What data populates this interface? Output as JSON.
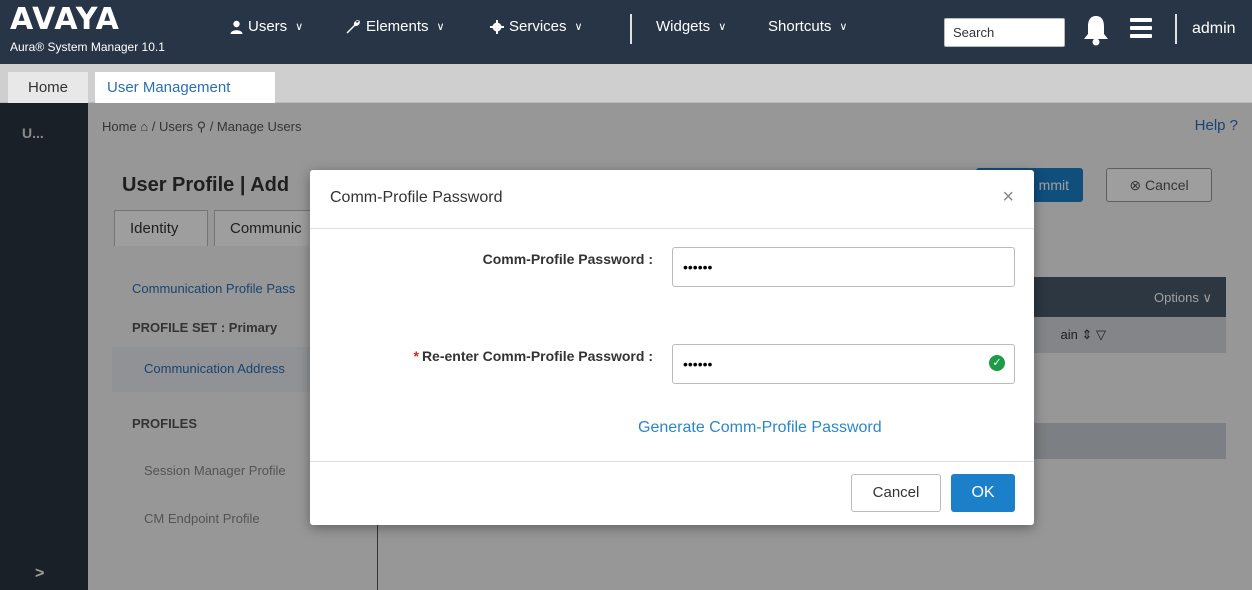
{
  "topbar": {
    "logo": "AVAYA",
    "product": "Aura® System Manager 10.1",
    "nav": [
      {
        "label": "Users",
        "icon": "user-icon"
      },
      {
        "label": "Elements",
        "icon": "wrench-icon"
      },
      {
        "label": "Services",
        "icon": "gear-icon"
      },
      {
        "label": "Widgets"
      },
      {
        "label": "Shortcuts"
      }
    ],
    "search_value": "Search",
    "user": "admin"
  },
  "tabs": {
    "home": "Home",
    "user_management": "User Management"
  },
  "rail": {
    "label": "U...",
    "expand": ">"
  },
  "page": {
    "breadcrumb": {
      "home": "Home",
      "users": "Users",
      "current": "Manage Users"
    },
    "help": "Help ?",
    "title": "User Profile | Add",
    "commit_fragment": "mmit",
    "cancel": "Cancel",
    "tab_identity": "Identity",
    "tab_comm": "Communic",
    "side_link": "Communication Profile Pass",
    "profile_set": "PROFILE SET : Primary",
    "comm_address": "Communication Address",
    "profiles_head": "PROFILES",
    "session_manager": "Session Manager Profile",
    "cm_endpoint": "CM Endpoint Profile",
    "options": "Options",
    "col_fragment": "ain"
  },
  "modal": {
    "title": "Comm-Profile Password",
    "close": "×",
    "field1_label": "Comm-Profile Password :",
    "field1_value": "••••••",
    "field2_label": "Re-enter Comm-Profile Password :",
    "field2_value": "••••••",
    "required_mark": "*",
    "generate_link": "Generate Comm-Profile Password",
    "cancel_label": "Cancel",
    "ok_label": "OK"
  },
  "colors": {
    "nav_bg": "#283547",
    "accent_blue": "#1b7fc9",
    "link_blue": "#2a6fb6",
    "valid_green": "#1e9b47",
    "required_red": "#d9261c"
  }
}
